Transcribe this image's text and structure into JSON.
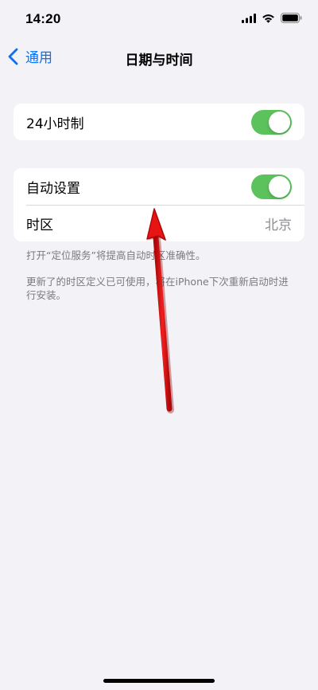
{
  "status_bar": {
    "time": "14:20",
    "icons": [
      "cellular-signal-icon",
      "wifi-icon",
      "battery-icon"
    ]
  },
  "nav": {
    "back_label": "通用",
    "title": "日期与时间"
  },
  "group1": {
    "row_24h": {
      "label": "24小时制",
      "toggle_on": true
    }
  },
  "group2": {
    "row_auto": {
      "label": "自动设置",
      "toggle_on": true
    },
    "row_timezone": {
      "label": "时区",
      "value": "北京"
    }
  },
  "notes": {
    "location_note": "打开“定位服务”将提高自动时区准确性。",
    "update_note": "更新了的时区定义已可使用，将在iPhone下次重新启动时进行安装。"
  },
  "colors": {
    "accent": "#0a72f0",
    "toggle_on": "#5cc25c",
    "background": "#f2f2f7",
    "annotation_arrow": "#e01010"
  }
}
